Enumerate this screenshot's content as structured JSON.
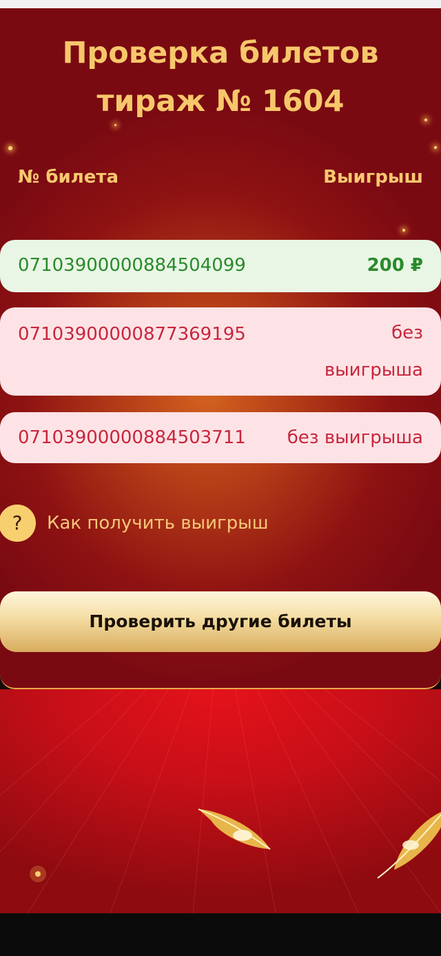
{
  "header": {
    "title_line1": "Проверка билетов",
    "title_line2": "тираж № 1604"
  },
  "table": {
    "col_ticket": "№ билета",
    "col_win": "Выигрыш",
    "rows": [
      {
        "ticket": "071039000008845040​99",
        "result": "200 ₽",
        "status": "win"
      },
      {
        "ticket": "07103900000877369195",
        "result": "без выигрыша",
        "status": "lose"
      },
      {
        "ticket": "07103900000884503711",
        "result": "без выигрыша",
        "status": "lose"
      }
    ]
  },
  "help": {
    "icon": "question-icon",
    "icon_glyph": "?",
    "label": "Как получить выигрыш"
  },
  "actions": {
    "check_other": "Проверить другие билеты"
  },
  "colors": {
    "accent_gold": "#f7c76b",
    "win_green": "#2a8a2c",
    "lose_red": "#c8263c",
    "background_red": "#8e1212"
  }
}
